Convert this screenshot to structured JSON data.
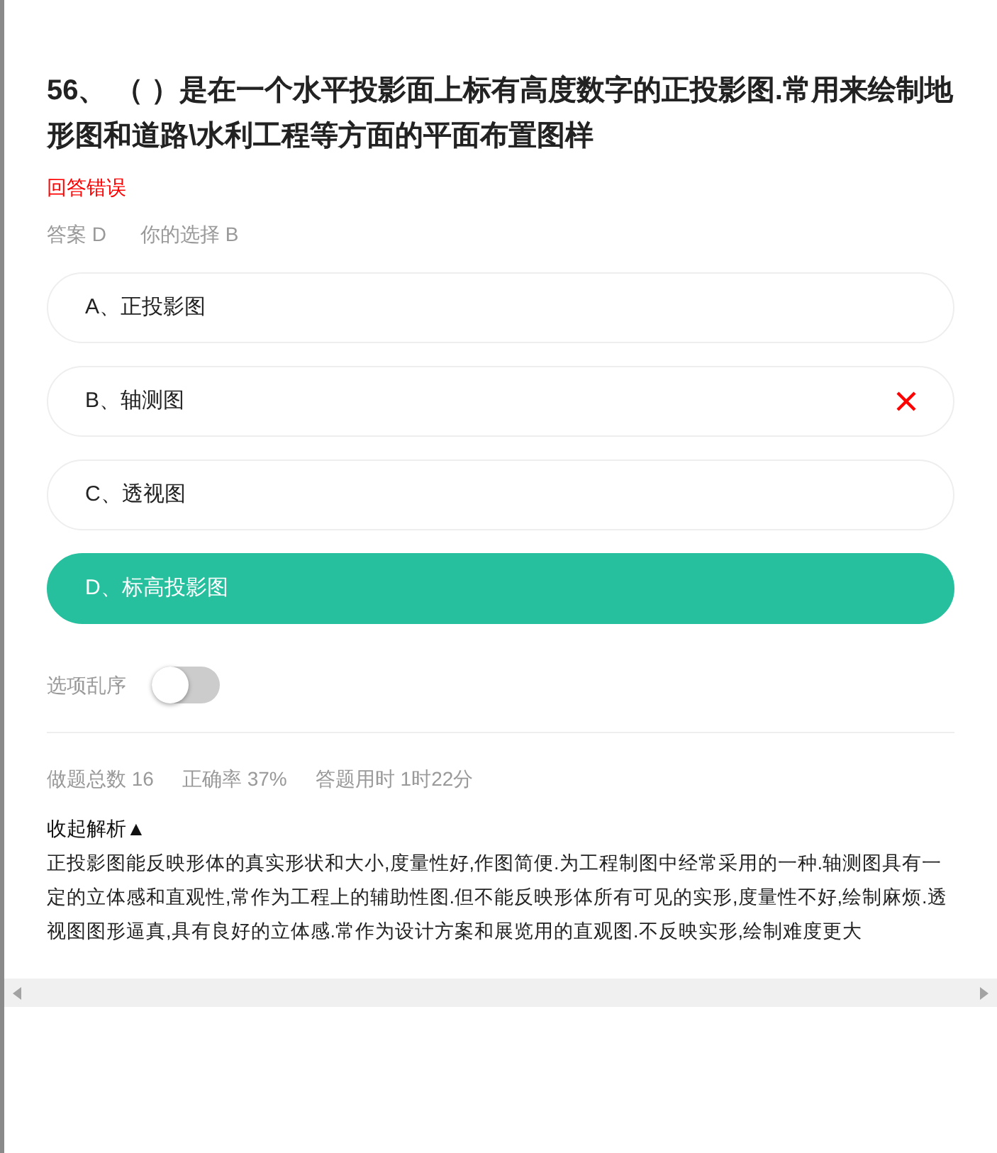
{
  "question": {
    "title": "56、 （ ）是在一个水平投影面上标有高度数字的正投影图.常用来绘制地形图和道路\\水利工程等方面的平面布置图样",
    "result": "回答错误",
    "answer": "答案 D",
    "your_choice": "你的选择 B"
  },
  "options": [
    {
      "label": "A、正投影图",
      "kind": "plain"
    },
    {
      "label": "B、轴测图",
      "kind": "wrong"
    },
    {
      "label": "C、透视图",
      "kind": "plain"
    },
    {
      "label": "D、标高投影图",
      "kind": "correct"
    }
  ],
  "shuffle": {
    "label": "选项乱序",
    "on": false
  },
  "stats": [
    "做题总数 16",
    "正确率 37%",
    "答题用时 1时22分"
  ],
  "analysis": {
    "toggle": "收起解析▲",
    "text": "正投影图能反映形体的真实形状和大小,度量性好,作图简便.为工程制图中经常采用的一种.轴测图具有一定的立体感和直观性,常作为工程上的辅助性图.但不能反映形体所有可见的实形,度量性不好,绘制麻烦.透视图图形逼真,具有良好的立体感.常作为设计方案和展览用的直观图.不反映实形,绘制难度更大"
  }
}
